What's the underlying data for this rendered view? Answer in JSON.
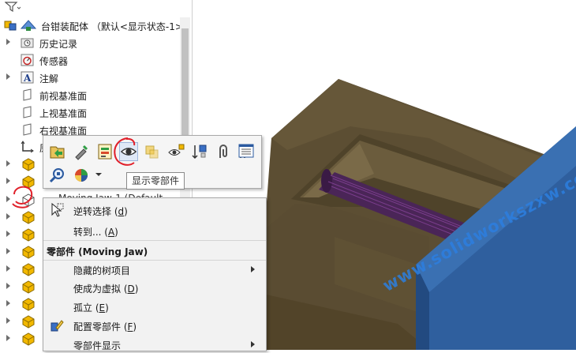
{
  "tree": {
    "root_label": "台钳装配体 （默认<显示状态-1>",
    "items": [
      {
        "label": "历史记录",
        "icon": "history-folder-icon"
      },
      {
        "label": "传感器",
        "icon": "sensor-icon"
      },
      {
        "label": "注解",
        "icon": "annotation-icon"
      },
      {
        "label": "前视基准面",
        "icon": "plane-icon"
      },
      {
        "label": "上视基准面",
        "icon": "plane-icon"
      },
      {
        "label": "右视基准面",
        "icon": "plane-icon"
      },
      {
        "label": "原",
        "icon": "origin-icon"
      }
    ],
    "partial_label": "Moving Jaw-1 (Default",
    "part_rows_count": 10
  },
  "toolbar": {
    "buttons": [
      "open-part-icon",
      "edit-part-icon",
      "assembly-visualization-icon",
      "show-component-icon",
      "change-transparency-icon",
      "hidden-components-icon",
      "component-properties-icon",
      "mate-icon",
      "view-mates-icon",
      "zoom-to-selection-icon",
      "appearance-icon"
    ],
    "tooltip": "显示零部件"
  },
  "menu": {
    "items_top": [
      {
        "label": "逆转选择 (",
        "key": "d",
        "suffix": ")",
        "icon": "cursor-select-icon"
      },
      {
        "label": "转到... (",
        "key": "A",
        "suffix": ")",
        "icon": ""
      }
    ],
    "section_title": "零部件 (Moving Jaw)",
    "items_bottom": [
      {
        "label": "隐藏的树项目",
        "submenu": true,
        "icon": ""
      },
      {
        "label": "使成为虚拟 (",
        "key": "D",
        "suffix": ")",
        "submenu": false,
        "icon": ""
      },
      {
        "label": "孤立 (",
        "key": "E",
        "suffix": ")",
        "submenu": false,
        "icon": ""
      },
      {
        "label": "配置零部件 (",
        "key": "F",
        "suffix": ")",
        "submenu": false,
        "icon": "configure-component-icon"
      },
      {
        "label": "零部件显示",
        "submenu": true,
        "icon": ""
      }
    ]
  },
  "viewport": {
    "watermark": "www.solidworkszxw.com",
    "colors": {
      "vise_body": "#5a4c32",
      "jaw": "#2e5f9c",
      "screw": "#5a2a66"
    }
  }
}
